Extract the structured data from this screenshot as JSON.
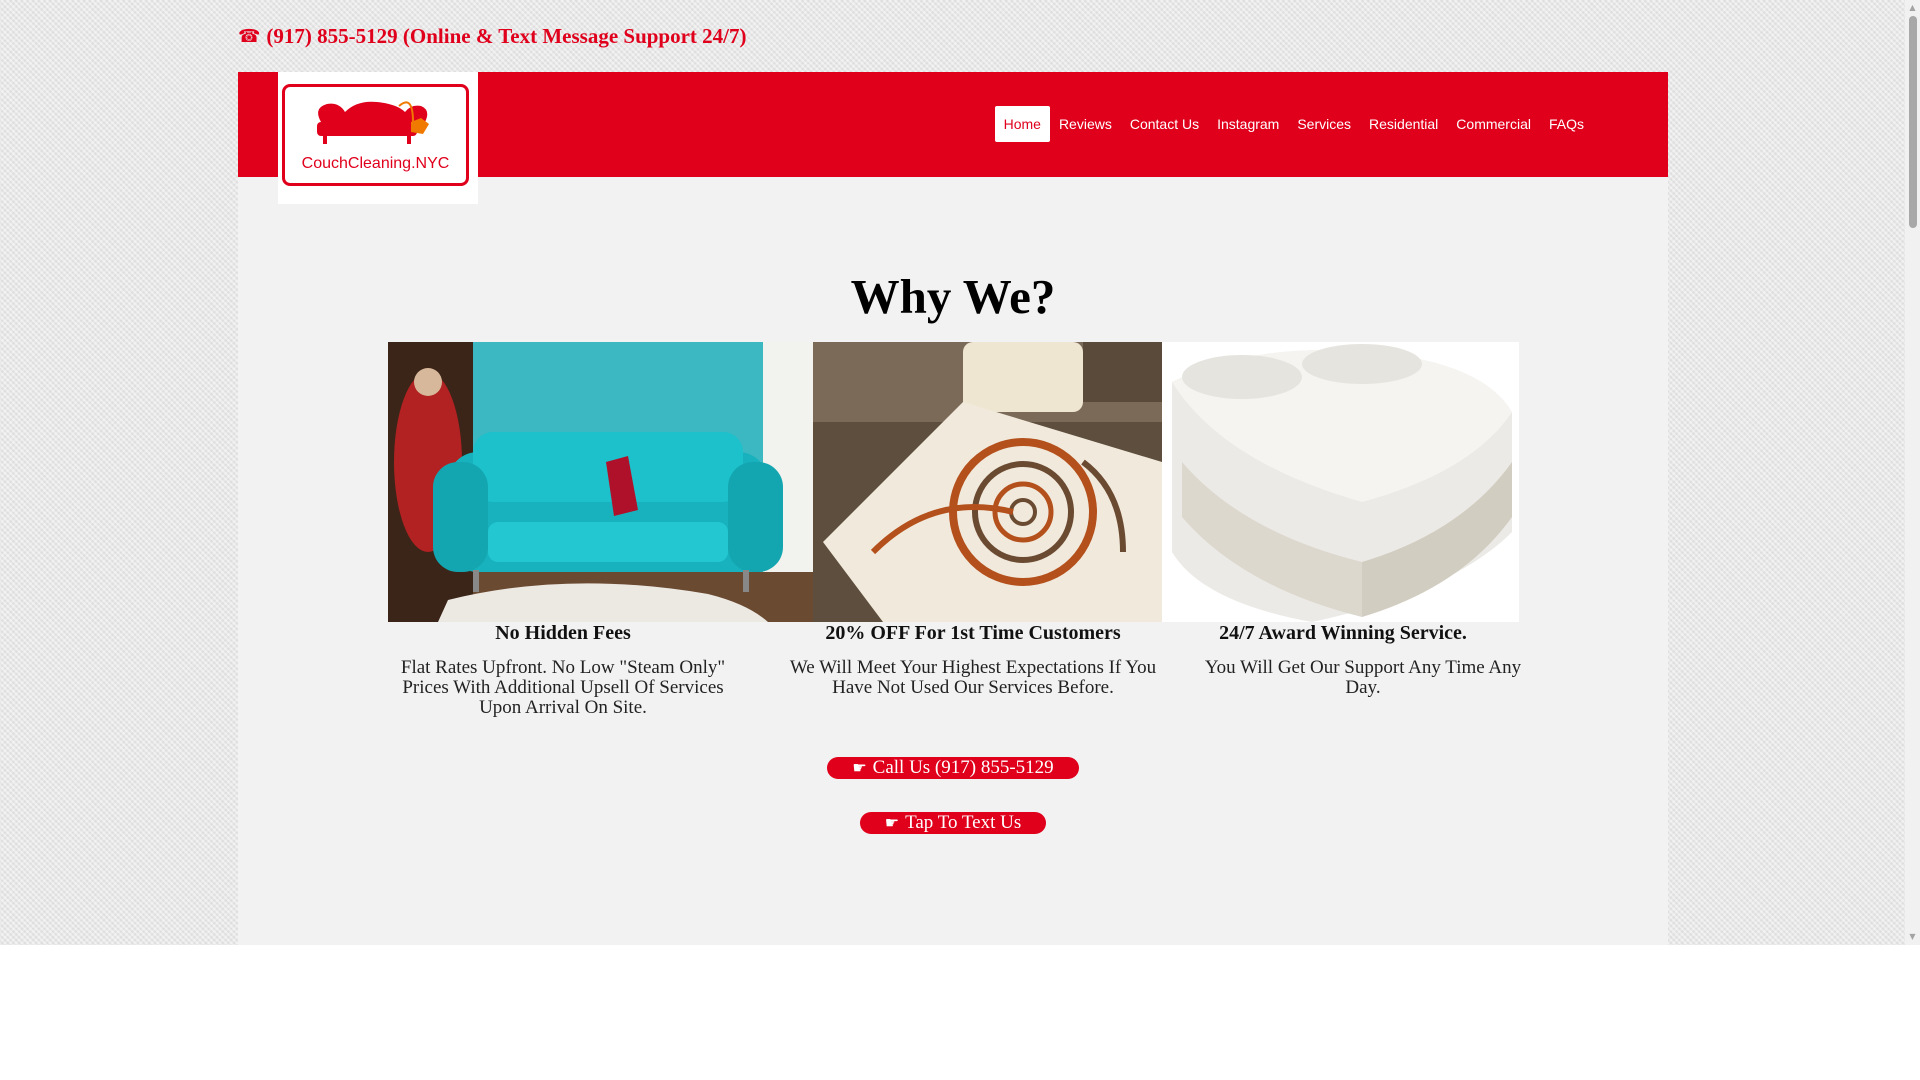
{
  "topbar": {
    "phone_icon": "☎",
    "phone_text": "(917) 855-5129 (Online & Text Message Support 24/7)"
  },
  "logo": {
    "text": "CouchCleaning.NYC",
    "icon": "couch-icon"
  },
  "nav": {
    "items": [
      {
        "label": "Home",
        "active": true
      },
      {
        "label": "Reviews",
        "active": false
      },
      {
        "label": "Contact Us",
        "active": false
      },
      {
        "label": "Instagram",
        "active": false
      },
      {
        "label": "Services",
        "active": false
      },
      {
        "label": "Residential",
        "active": false
      },
      {
        "label": "Commercial",
        "active": false
      },
      {
        "label": "FAQs",
        "active": false
      }
    ]
  },
  "main": {
    "heading": "Why We?",
    "features": [
      {
        "title": "No Hidden Fees",
        "text": "Flat Rates Upfront. No Low \"Steam Only\" Prices With Additional Upsell Of Services Upon Arrival On Site.",
        "image": "teal-sofa-image"
      },
      {
        "title": "20% OFF For 1st Time Customers",
        "text": "We Will Meet Your Highest Expectations If You Have Not Used Our Services Before.",
        "image": "swirl-rug-image"
      },
      {
        "title": "24/7 Award Winning Service.",
        "text": "You Will Get Our Support Any Time Any Day.",
        "image": "mattress-image"
      }
    ],
    "cta": {
      "pointer_icon": "☛",
      "call_label": "Call Us (917) 855-5129",
      "text_label": "Tap To Text Us"
    }
  },
  "colors": {
    "brand_red": "#e0001c",
    "background": "#e6e6e6",
    "content": "#f2f2f2"
  }
}
